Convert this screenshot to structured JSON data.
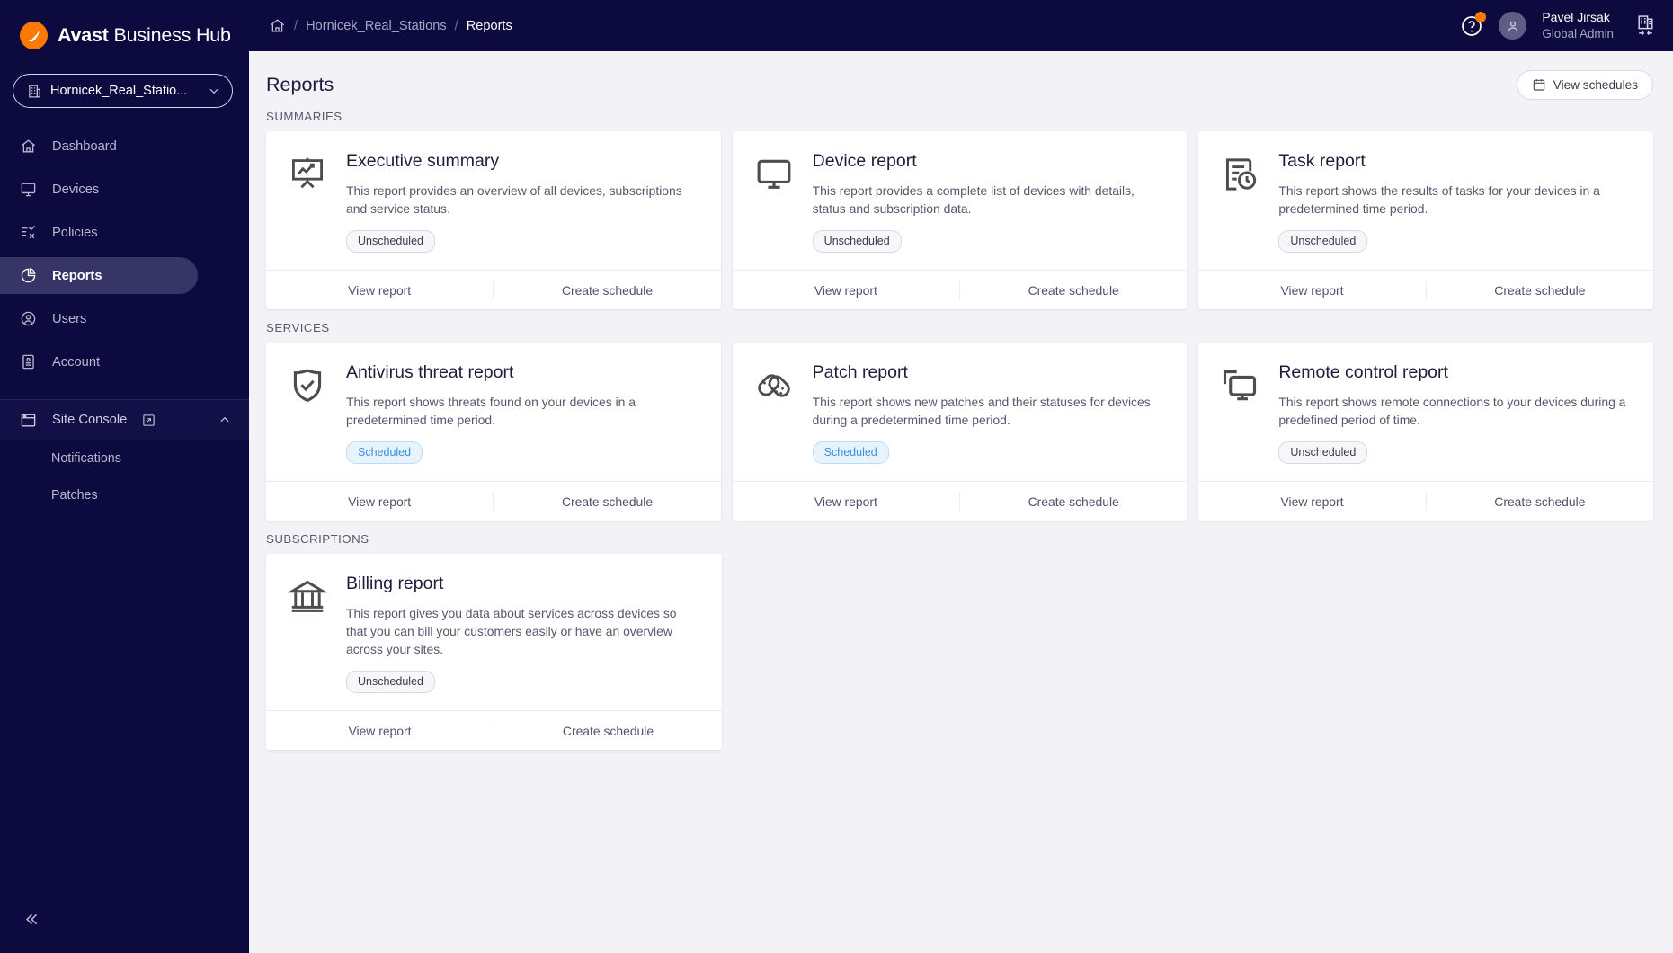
{
  "brand": {
    "name_bold": "Avast",
    "name_rest": " Business Hub",
    "logo_icon": "avast-logo-icon",
    "logo_color": "#ff7800"
  },
  "sidebar": {
    "site_selector": {
      "label": "Hornicek_Real_Statio...",
      "icon": "building-icon",
      "chevron": "chevron-down-icon"
    },
    "items": [
      {
        "label": "Dashboard",
        "icon": "home-icon",
        "active": false
      },
      {
        "label": "Devices",
        "icon": "monitor-icon",
        "active": false
      },
      {
        "label": "Policies",
        "icon": "policies-icon",
        "active": false
      },
      {
        "label": "Reports",
        "icon": "pie-chart-icon",
        "active": true
      },
      {
        "label": "Users",
        "icon": "user-circle-icon",
        "active": false
      },
      {
        "label": "Account",
        "icon": "account-card-icon",
        "active": false
      }
    ],
    "site_console": {
      "label": "Site Console",
      "icon": "window-icon",
      "external_icon": "external-link-icon",
      "chevron": "chevron-up-icon"
    },
    "sub_items": [
      {
        "label": "Notifications"
      },
      {
        "label": "Patches"
      }
    ],
    "collapse": {
      "icon": "chevron-double-left-icon"
    }
  },
  "topbar": {
    "home_icon": "home-icon",
    "breadcrumb": [
      {
        "label": "Hornicek_Real_Stations",
        "current": false
      },
      {
        "label": "Reports",
        "current": true
      }
    ],
    "separator": "/",
    "help_icon": "help-circle-icon",
    "notification_dot_color": "#ff7800",
    "avatar_icon": "user-avatar-icon",
    "user_name": "Pavel Jirsak",
    "user_role": "Global Admin",
    "switch_icon": "switch-company-icon"
  },
  "page": {
    "title": "Reports",
    "view_schedules": {
      "label": "View schedules",
      "icon": "calendar-icon"
    },
    "actions": {
      "view_report": "View report",
      "create_schedule": "Create schedule"
    },
    "sections": [
      {
        "label": "SUMMARIES",
        "cards": [
          {
            "title": "Executive summary",
            "desc": "This report provides an overview of all devices, subscriptions and service status.",
            "badge": "Unscheduled",
            "scheduled": false,
            "icon": "presentation-chart-icon"
          },
          {
            "title": "Device report",
            "desc": "This report provides a complete list of devices with details, status and subscription data.",
            "badge": "Unscheduled",
            "scheduled": false,
            "icon": "monitor-icon"
          },
          {
            "title": "Task report",
            "desc": "This report shows the results of tasks for your devices in a predetermined time period.",
            "badge": "Unscheduled",
            "scheduled": false,
            "icon": "document-clock-icon"
          }
        ]
      },
      {
        "label": "SERVICES",
        "cards": [
          {
            "title": "Antivirus threat report",
            "desc": "This report shows threats found on your devices in a predetermined time period.",
            "badge": "Scheduled",
            "scheduled": true,
            "icon": "shield-check-icon"
          },
          {
            "title": "Patch report",
            "desc": "This report shows new patches and their statuses for devices during a predetermined time period.",
            "badge": "Scheduled",
            "scheduled": true,
            "icon": "bandage-patch-icon"
          },
          {
            "title": "Remote control report",
            "desc": "This report shows remote connections to your devices during a predefined period of time.",
            "badge": "Unscheduled",
            "scheduled": false,
            "icon": "remote-monitor-icon"
          }
        ]
      },
      {
        "label": "SUBSCRIPTIONS",
        "cards": [
          {
            "title": "Billing report",
            "desc": "This report gives you data about services across devices so that you can bill your customers easily or have an overview across your sites.",
            "badge": "Unscheduled",
            "scheduled": false,
            "icon": "bank-building-icon"
          }
        ]
      }
    ]
  },
  "colors": {
    "sidebar_bg": "#0c0a3e",
    "active_pill": "#363566",
    "accent_orange": "#ff7800",
    "scheduled_blue": "#3b8fe0",
    "content_bg": "#f3f2f7"
  }
}
